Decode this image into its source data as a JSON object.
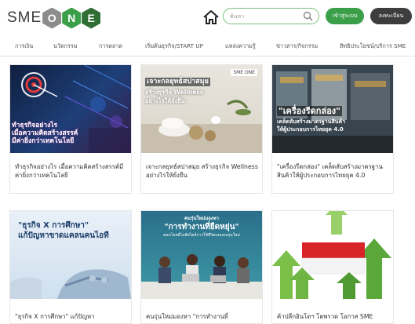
{
  "header": {
    "logo_sme": "SME",
    "logo_letters": [
      "O",
      "N",
      "E"
    ],
    "logo_colors": [
      "#8c8c8c",
      "#3b9e48",
      "#2f6e35"
    ],
    "search_placeholder": "ค้นหา",
    "login_label": "เข้าสู่ระบบ",
    "register_label": "ลงทะเบียน"
  },
  "nav": {
    "items": [
      "การเงิน",
      "นวัตกรรม",
      "การตลาด",
      "เริ่มต้นธุรกิจ/START UP",
      "แหล่งความรู้",
      "ข่าวสาร/กิจกรรม",
      "สิทธิประโยชน์/บริการ SME"
    ]
  },
  "cards": [
    {
      "image_text": [
        "ทำธุรกิจอย่างไร",
        "เมื่อความคิดสร้างสรรค์",
        "มีค่ายิ่งกว่าเทคโนโลยี"
      ],
      "title": "ทำธุรกิจอย่างไร เมื่อความคิดสร้างสรรค์มีค่ายิ่งกว่าเทคโนโลยี"
    },
    {
      "image_text": [
        "เจาะกลยุทธ์สปาสมุย",
        "สร้างธุรกิจ Wellness",
        "อย่างไรให้ยั่งยืน"
      ],
      "image_badge": "SME ONE",
      "title": "เจาะกลยุทธ์สปาสมุย สร้างธุรกิจ Wellness อย่างไรให้ยั่งยืน"
    },
    {
      "image_text": [
        "\"เครื่องรีดกล่อง\"",
        "เคล็ดลับสร้างมาตรฐานสินค้า",
        "ให้ผู้ประกอบการไทยยุค 4.0"
      ],
      "title": "\"เครื่องรีดกล่อง\" เคล็ดลับสร้างมาตรฐานสินค้าให้ผู้ประกอบการไทยยุค 4.0"
    },
    {
      "image_text": [
        "\"ธุรกิจ X การศึกษา\"",
        "แก้ปัญหาขาดแคลนคนไอที"
      ],
      "title": "\"ธุรกิจ X การศึกษา\" แก้ปัญหา"
    },
    {
      "image_text": [
        "คนรุ่นใหม่มองหา",
        "\"การทำงานที่ยืดหยุ่น\"",
        "ตอบโจทย์ไลฟ์สไตล์การใช้ชีวิตแบบคนรุ่นใหม่"
      ],
      "title": "คนรุ่นใหม่มองหา \"การทำงานที่"
    },
    {
      "image_text": [],
      "title": "ค้าปลีกอินโดฯ โตพรวด โอกาส SME"
    }
  ]
}
